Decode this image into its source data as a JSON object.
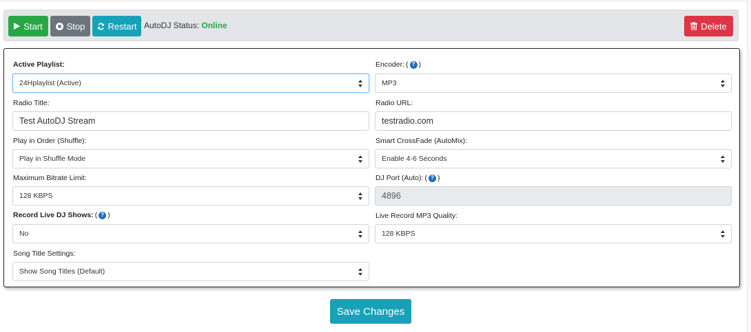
{
  "toolbar": {
    "start_label": "Start",
    "stop_label": "Stop",
    "restart_label": "Restart",
    "status_label": "AutoDJ Status:",
    "status_value": "Online",
    "delete_label": "Delete"
  },
  "form": {
    "active_playlist": {
      "label": "Active Playlist:",
      "value": "24Hplaylist (Active)"
    },
    "encoder": {
      "label": "Encoder:",
      "value": "MP3"
    },
    "radio_title": {
      "label": "Radio Title:",
      "value": "Test AutoDJ Stream"
    },
    "radio_url": {
      "label": "Radio URL:",
      "value": "testradio.com"
    },
    "play_order": {
      "label": "Play in Order (Shuffle):",
      "value": "Play in Shuffle Mode"
    },
    "crossfade": {
      "label": "Smart CrossFade (AutoMix):",
      "value": "Enable 4-6 Seconds"
    },
    "max_bitrate": {
      "label": "Maximum Bitrate Limit:",
      "value": "128 KBPS"
    },
    "dj_port": {
      "label": "DJ Port (Auto):",
      "value": "4896"
    },
    "record_live": {
      "label": "Record Live DJ Shows:",
      "value": "No"
    },
    "record_quality": {
      "label": "Live Record MP3 Quality:",
      "value": "128 KBPS"
    },
    "song_title": {
      "label": "Song Title Settings:",
      "value": "Show Song Titles (Default)"
    }
  },
  "help_glyph": "?",
  "save_label": "Save Changes",
  "colors": {
    "success": "#28a745",
    "secondary": "#6c757d",
    "info": "#17a2b8",
    "danger": "#dc3545",
    "help": "#1f6fc4"
  },
  "icons": [
    "play-icon",
    "stop-circle-icon",
    "refresh-icon",
    "trash-icon",
    "help-icon",
    "select-caret-icon"
  ]
}
